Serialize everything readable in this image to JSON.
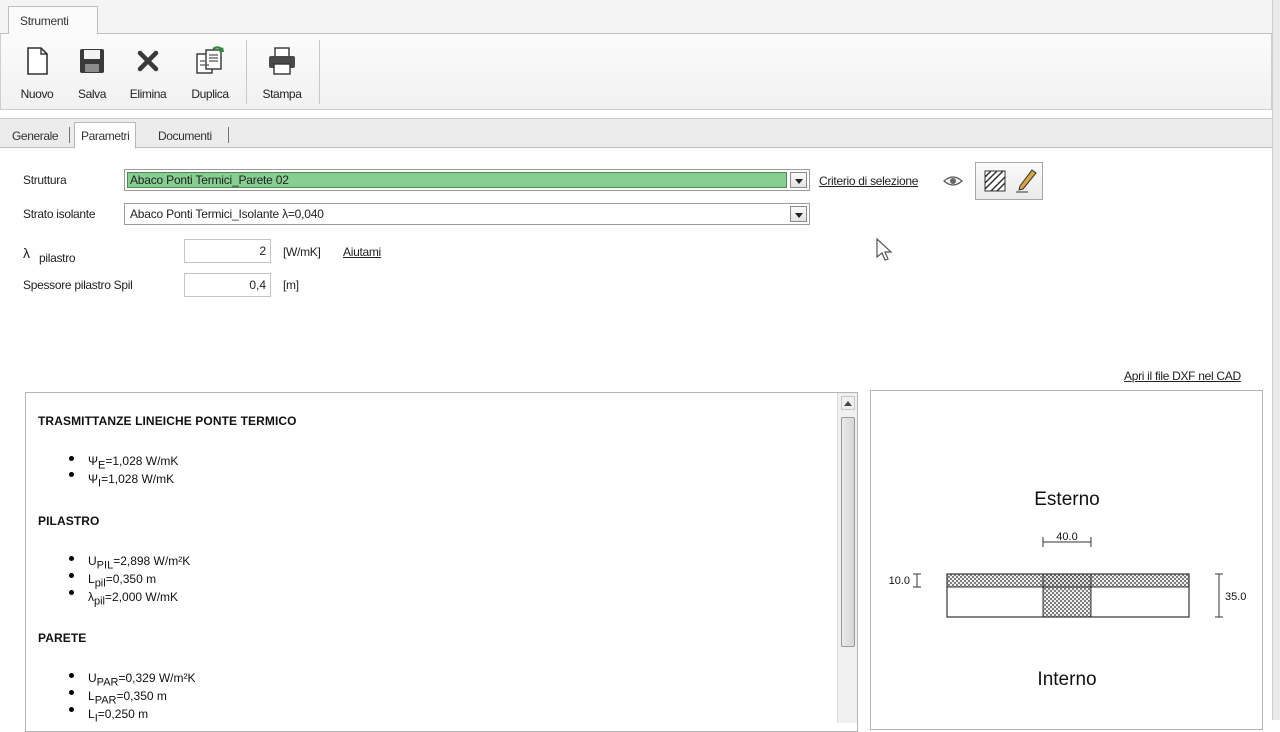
{
  "ribbon": {
    "tab_label": "Strumenti",
    "buttons": [
      {
        "label": "Nuovo",
        "icon": "new-document-icon"
      },
      {
        "label": "Salva",
        "icon": "floppy-disk-icon"
      },
      {
        "label": "Elimina",
        "icon": "delete-x-icon"
      },
      {
        "label": "Duplica",
        "icon": "duplicate-icon"
      },
      {
        "label": "Stampa",
        "icon": "printer-icon"
      }
    ]
  },
  "subtabs": [
    "Generale",
    "Parametri",
    "Documenti"
  ],
  "active_subtab": "Parametri",
  "form": {
    "struttura_label": "Struttura",
    "struttura_value": "Abaco Ponti Termici_Parete 02",
    "strato_label": "Strato isolante",
    "strato_value": "Abaco Ponti Termici_Isolante λ=0,040",
    "criterio_link": "Criterio di selezione",
    "lambda_symbol": "λ",
    "lambda_sub": "pilastro",
    "lambda_value": "2",
    "lambda_unit": "[W/mK]",
    "aiutami_link": "Aiutami",
    "spessore_label": "Spessore pilastro Spil",
    "spessore_value": "0,4",
    "spessore_unit": "[m]",
    "selected_highlight": "#86cf91"
  },
  "dxf_link": "Apri il file DXF nel CAD",
  "report": {
    "sections": [
      {
        "title": "TRASMITTANZE LINEICHE PONTE TERMICO",
        "items": [
          {
            "sym": "Ψ",
            "sub": "E",
            "text": "=1,028 W/mK"
          },
          {
            "sym": "Ψ",
            "sub": "I",
            "text": "=1,028 W/mK"
          }
        ]
      },
      {
        "title": "PILASTRO",
        "items": [
          {
            "sym": "U",
            "sub": "PIL",
            "text": "=2,898 W/m²K"
          },
          {
            "sym": "L",
            "sub": "pil",
            "text": "=0,350 m"
          },
          {
            "sym": "λ",
            "sub": "pil",
            "text": "=2,000 W/mK"
          }
        ]
      },
      {
        "title": "PARETE",
        "items": [
          {
            "sym": "U",
            "sub": "PAR",
            "text": "=0,329 W/m²K"
          },
          {
            "sym": "L",
            "sub": "PAR",
            "text": "=0,350 m"
          },
          {
            "sym": "L",
            "sub": "I",
            "text": "=0,250 m"
          }
        ]
      }
    ]
  },
  "drawing": {
    "esterno": "Esterno",
    "interno": "Interno",
    "dim_top": "40.0",
    "dim_left": "10.0",
    "dim_right": "35.0"
  }
}
